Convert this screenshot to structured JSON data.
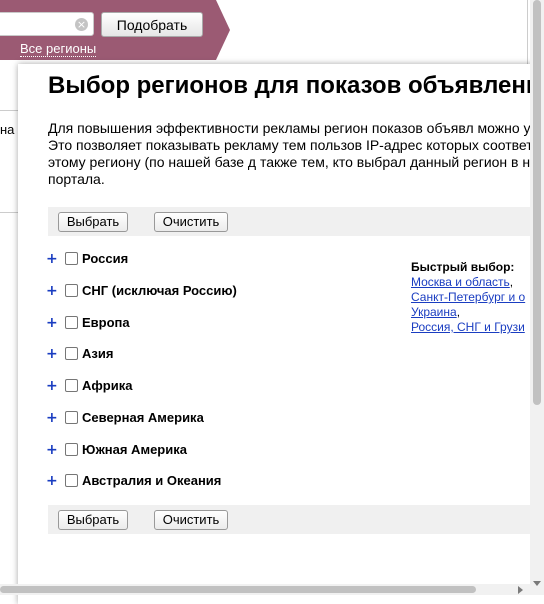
{
  "background": {
    "pick_button": "Подобрать",
    "all_regions_link": "Все регионы",
    "left_fragment": "на",
    "clear_icon": "×"
  },
  "modal": {
    "title": "Выбор регионов для показов объявлени",
    "description": "Для повышения эффективности рекламы регион показов объявл можно уточнить. Это позволяет показывать рекламу тем пользов IP-адрес которых соответствует этому региону (по нашей базе д также тем, кто выбрал данный регион в настройках портала.",
    "select_button": "Выбрать",
    "clear_button": "Очистить",
    "expand_glyph": "+",
    "regions": [
      {
        "label": "Россия",
        "checked": false
      },
      {
        "label": "СНГ (исключая Россию)",
        "checked": false
      },
      {
        "label": "Европа",
        "checked": false
      },
      {
        "label": "Азия",
        "checked": false
      },
      {
        "label": "Африка",
        "checked": false
      },
      {
        "label": "Северная Америка",
        "checked": false
      },
      {
        "label": "Южная Америка",
        "checked": false
      },
      {
        "label": "Австралия и Океания",
        "checked": false
      }
    ],
    "quick_select": {
      "title": "Быстрый выбор:",
      "links": [
        "Москва и область",
        "Санкт-Петербург и о",
        "Украина",
        "Россия, СНГ и Грузи"
      ],
      "separator": ","
    }
  },
  "colors": {
    "header_bar": "#9b5a73",
    "link": "#1a3dc1",
    "toolbar": "#f0f0f0"
  }
}
